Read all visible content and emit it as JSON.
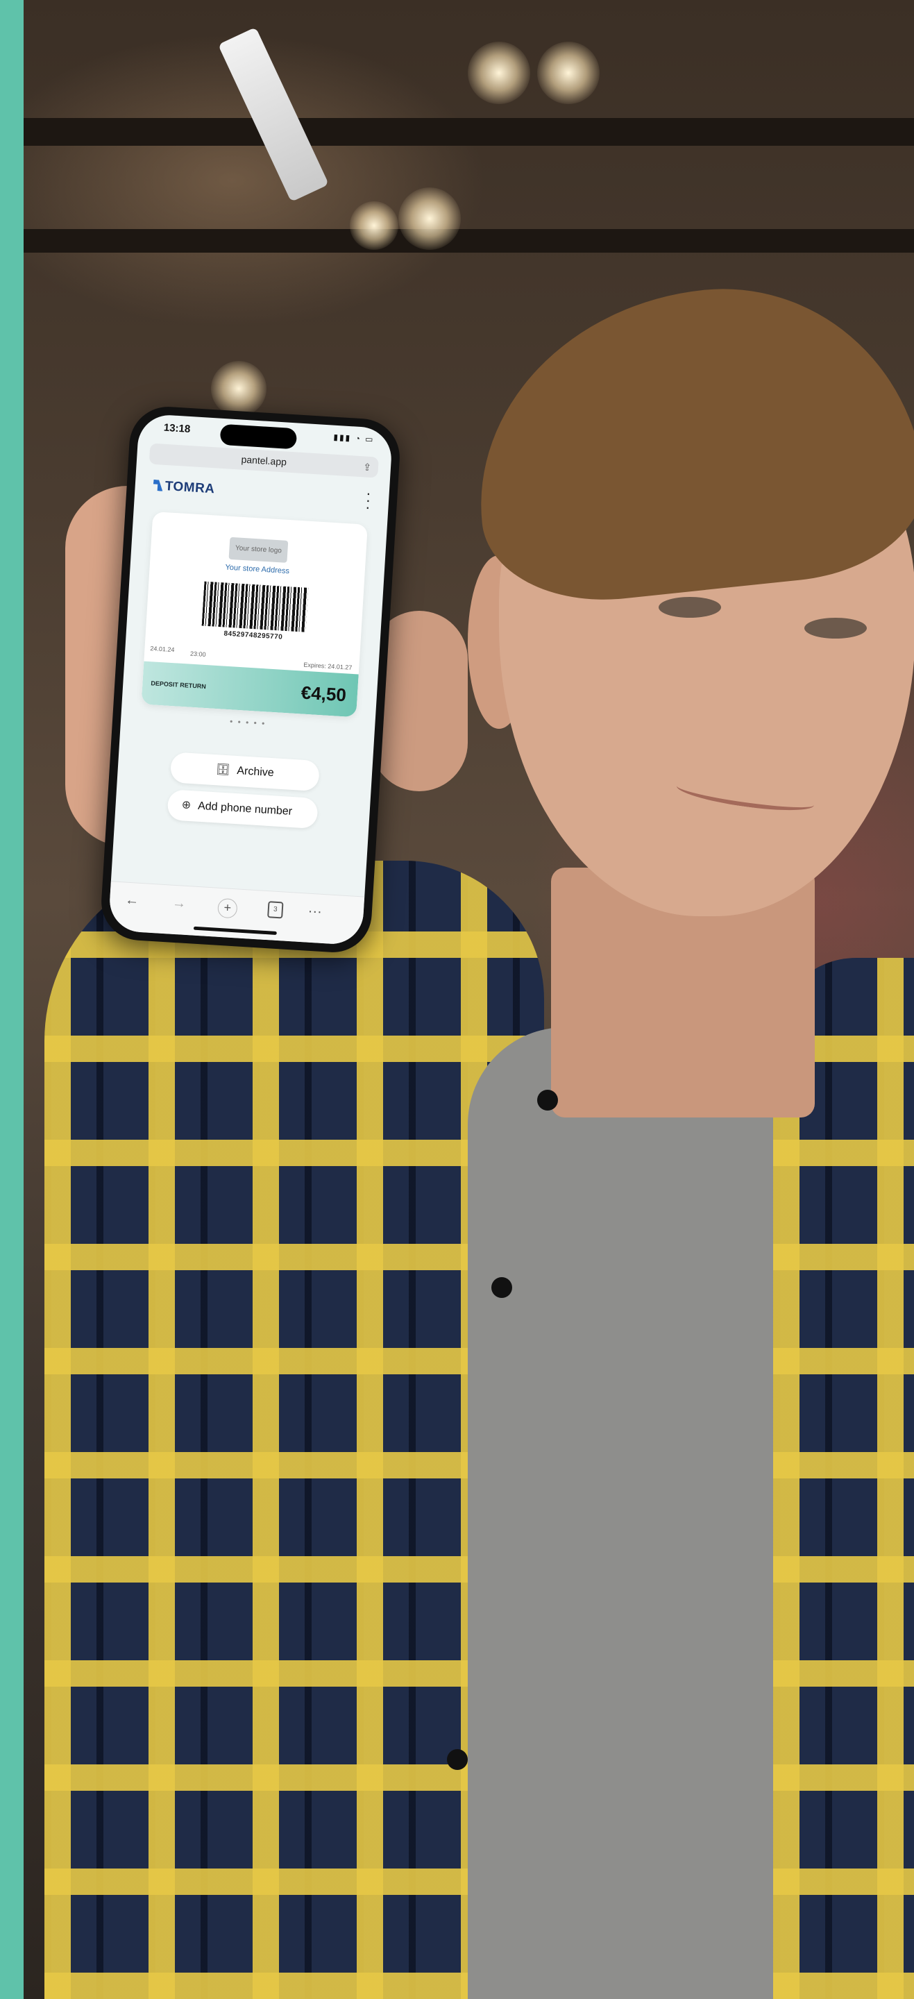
{
  "phone": {
    "status_time": "13:18",
    "url": "pantel.app",
    "brand": "TOMRA",
    "receipt": {
      "store_logo": "Your store logo",
      "store_address": "Your store Address",
      "barcode_number": "84529748295770",
      "issued_date": "24.01.24",
      "issued_time": "23:00",
      "expires": "Expires: 24.01.27",
      "deposit_label": "DEPOSIT RETURN",
      "deposit_amount": "€4,50"
    },
    "pager": "• • • • •",
    "archive_label": "Archive",
    "add_phone_label": "Add phone number",
    "toolbar": {
      "back": "←",
      "forward": "→",
      "new_tab": "+",
      "tabs": "3",
      "more": "···"
    }
  },
  "colors": {
    "stripe": "#5fc2aa",
    "deposit_band": "#6fc6b4",
    "brand_blue": "#1d3c78"
  }
}
